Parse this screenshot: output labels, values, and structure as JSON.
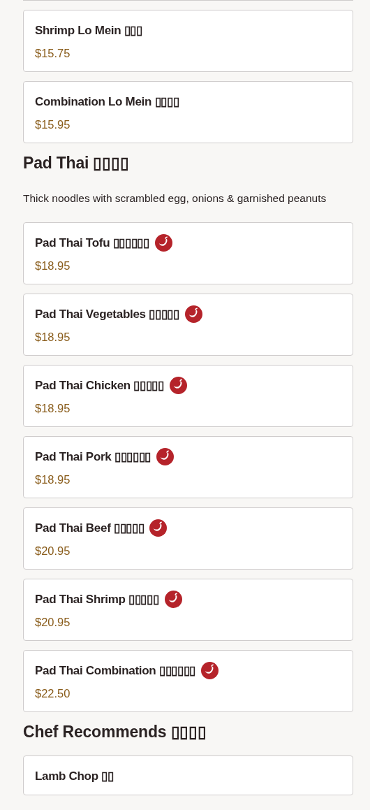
{
  "sections": [
    {
      "items": [
        {
          "name": "Shrimp Lo Mein ▯▯▯",
          "price": "$15.75",
          "spicy": false
        },
        {
          "name": "Combination Lo Mein ▯▯▯▯",
          "price": "$15.95",
          "spicy": false
        }
      ]
    },
    {
      "title": "Pad Thai ▯▯▯▯",
      "description": "Thick noodles with scrambled egg, onions & garnished peanuts",
      "items": [
        {
          "name": "Pad Thai Tofu ▯▯▯▯▯▯",
          "price": "$18.95",
          "spicy": true
        },
        {
          "name": "Pad Thai Vegetables ▯▯▯▯▯",
          "price": "$18.95",
          "spicy": true
        },
        {
          "name": "Pad Thai Chicken ▯▯▯▯▯",
          "price": "$18.95",
          "spicy": true
        },
        {
          "name": "Pad Thai Pork ▯▯▯▯▯▯",
          "price": "$18.95",
          "spicy": true
        },
        {
          "name": "Pad Thai Beef ▯▯▯▯▯",
          "price": "$20.95",
          "spicy": true
        },
        {
          "name": "Pad Thai Shrimp ▯▯▯▯▯",
          "price": "$20.95",
          "spicy": true
        },
        {
          "name": "Pad Thai Combination ▯▯▯▯▯▯",
          "price": "$22.50",
          "spicy": true
        }
      ]
    },
    {
      "title": "Chef Recommends ▯▯▯▯",
      "items": [
        {
          "name": "Lamb Chop ▯▯",
          "spicy": false
        }
      ]
    }
  ]
}
